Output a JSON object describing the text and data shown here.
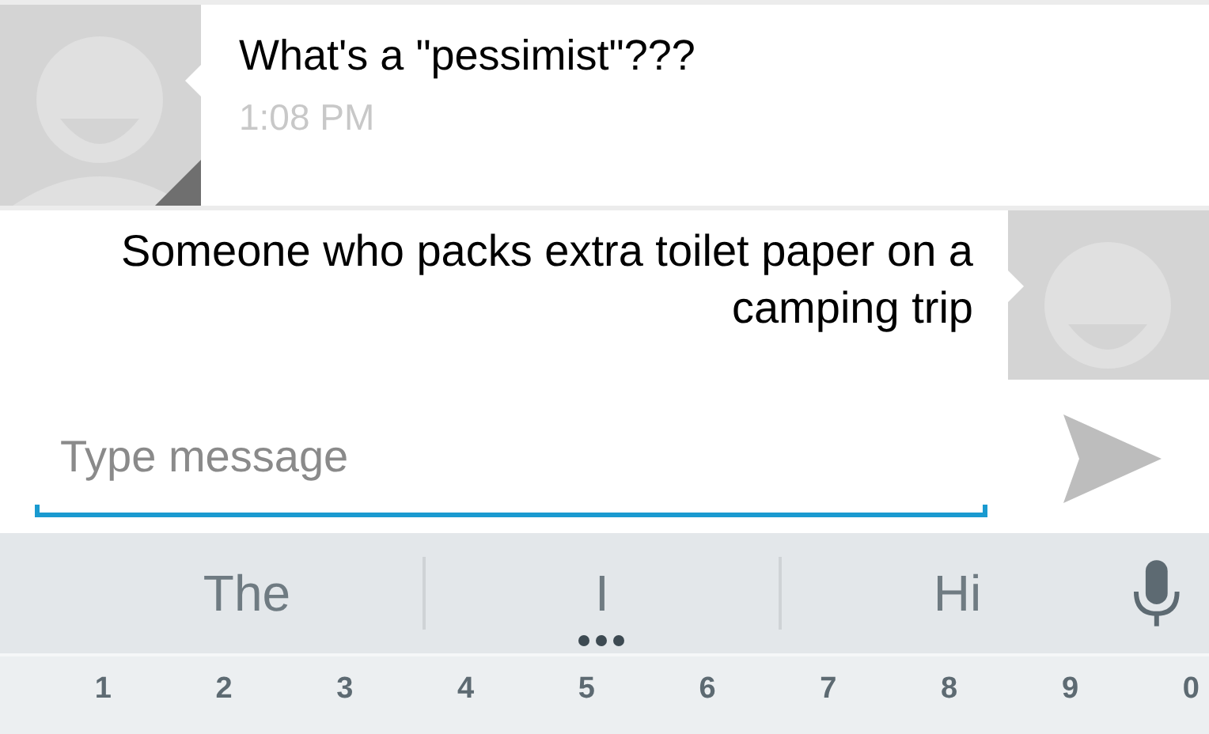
{
  "messages": [
    {
      "kind": "incoming",
      "text": "What's a \"pessimist\"???",
      "time": "1:08 PM"
    },
    {
      "kind": "outgoing",
      "text": "Someone who packs extra toilet paper on a camping trip"
    }
  ],
  "composer": {
    "placeholder": "Type message"
  },
  "suggestions": [
    {
      "text": "The",
      "has_more": false
    },
    {
      "text": "I",
      "has_more": true
    },
    {
      "text": "Hi",
      "has_more": false
    }
  ],
  "keys": [
    "1",
    "2",
    "3",
    "4",
    "5",
    "6",
    "7",
    "8",
    "9",
    "0"
  ]
}
